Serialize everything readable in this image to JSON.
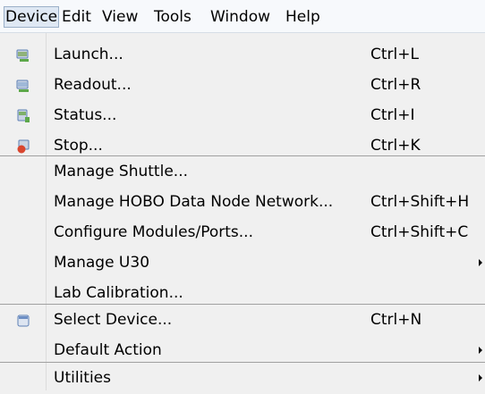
{
  "menubar": {
    "items": [
      {
        "label": "Device"
      },
      {
        "label": "Edit"
      },
      {
        "label": "View"
      },
      {
        "label": "Tools"
      },
      {
        "label": "Window"
      },
      {
        "label": "Help"
      }
    ]
  },
  "device_menu": {
    "items": [
      {
        "label": "Launch...",
        "shortcut": "Ctrl+L",
        "icon": "launch-icon"
      },
      {
        "label": "Readout...",
        "shortcut": "Ctrl+R",
        "icon": "readout-icon"
      },
      {
        "label": "Status...",
        "shortcut": "Ctrl+I",
        "icon": "status-icon"
      },
      {
        "label": "Stop...",
        "shortcut": "Ctrl+K",
        "icon": "stop-icon"
      },
      {
        "label": "Manage Shuttle..."
      },
      {
        "label": "Manage HOBO Data Node Network...",
        "shortcut": "Ctrl+Shift+H"
      },
      {
        "label": "Configure Modules/Ports...",
        "shortcut": "Ctrl+Shift+C"
      },
      {
        "label": "Manage U30",
        "submenu": true
      },
      {
        "label": "Lab Calibration..."
      },
      {
        "label": "Select Device...",
        "shortcut": "Ctrl+N",
        "icon": "select-device-icon"
      },
      {
        "label": "Default Action",
        "submenu": true
      },
      {
        "label": "Utilities",
        "submenu": true
      }
    ]
  },
  "colors": {
    "icon_green": "#5da84a",
    "icon_red": "#d9462f",
    "icon_blue": "#5d7fb5"
  }
}
